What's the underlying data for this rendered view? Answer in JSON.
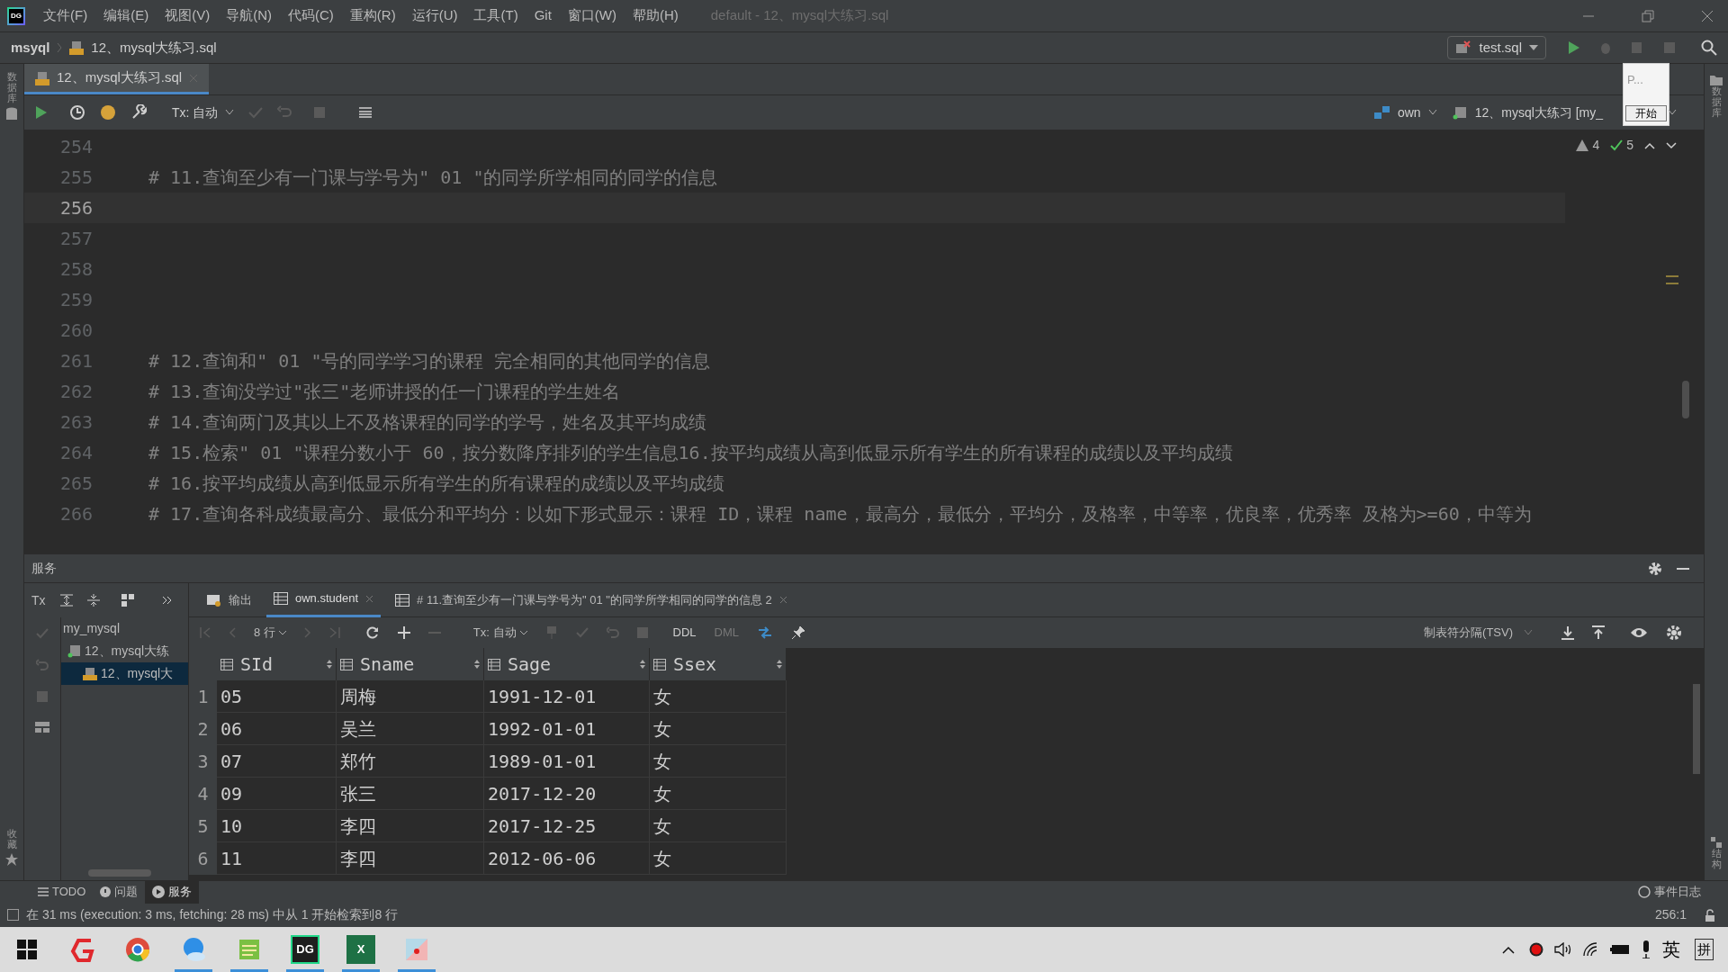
{
  "window": {
    "logo": "DG",
    "title": "default - 12、mysql大练习.sql",
    "menu": [
      "文件(F)",
      "编辑(E)",
      "视图(V)",
      "导航(N)",
      "代码(C)",
      "重构(R)",
      "运行(U)",
      "工具(T)",
      "Git",
      "窗口(W)",
      "帮助(H)"
    ]
  },
  "navbar": {
    "breadcrumb": [
      "msyql",
      "12、mysql大练习.sql"
    ],
    "run_config": "test.sql"
  },
  "editor_tabs": [
    {
      "label": "12、mysql大练习.sql",
      "selected": true
    }
  ],
  "editor_toolbar": {
    "tx": "Tx: 自动",
    "schema": "own",
    "session": "12、mysql大练习 [my_"
  },
  "popup": {
    "text": "P...",
    "button": "开始"
  },
  "inspections": {
    "warnings": "4",
    "passed": "5"
  },
  "editor": {
    "lines": [
      {
        "number": "254",
        "current": false
      },
      {
        "number": "255",
        "text": "# 11.查询至少有一门课与学号为\" 01 \"的同学所学相同的同学的信息",
        "current": false
      },
      {
        "number": "256",
        "current": true
      },
      {
        "number": "257",
        "current": false
      },
      {
        "number": "258",
        "current": false
      },
      {
        "number": "259",
        "current": false
      },
      {
        "number": "260",
        "current": false
      },
      {
        "number": "261",
        "text": "# 12.查询和\" 01 \"号的同学学习的课程 完全相同的其他同学的信息",
        "current": false
      },
      {
        "number": "262",
        "text": "# 13.查询没学过\"张三\"老师讲授的任一门课程的学生姓名",
        "current": false
      },
      {
        "number": "263",
        "text": "# 14.查询两门及其以上不及格课程的同学的学号，姓名及其平均成绩",
        "current": false
      },
      {
        "number": "264",
        "text": "# 15.检索\" 01 \"课程分数小于 60，按分数降序排列的学生信息16.按平均成绩从高到低显示所有学生的所有课程的成绩以及平均成绩",
        "current": false
      },
      {
        "number": "265",
        "text": "# 16.按平均成绩从高到低显示所有学生的所有课程的成绩以及平均成绩",
        "current": false
      },
      {
        "number": "266",
        "text": "# 17.查询各科成绩最高分、最低分和平均分：以如下形式显示：课程 ID，课程 name，最高分，最低分，平均分，及格率，中等率，优良率，优秀率 及格为>=60，中等为",
        "current": false
      }
    ]
  },
  "side_labels": {
    "left_top": "数据库",
    "left_bottom": "收藏",
    "right_top": "数据库",
    "right_bottom": "结构"
  },
  "services": {
    "title": "服务",
    "tree_tx": "Tx",
    "tree": [
      {
        "label": "my_mysql",
        "selected": false,
        "children": [
          {
            "label": "12、mysql大练",
            "kind": "session",
            "selected": false,
            "children": [
              {
                "label": "12、mysql大",
                "kind": "file",
                "selected": true
              }
            ]
          }
        ]
      }
    ],
    "tabs": [
      {
        "label": "输出",
        "kind": "output",
        "selected": false
      },
      {
        "label": "own.student",
        "kind": "table",
        "selected": true
      },
      {
        "label": "# 11.查询至少有一门课与学号为\" 01 \"的同学所学相同的同学的信息 2",
        "kind": "table",
        "selected": false
      }
    ],
    "toolbar": {
      "rows": "8 行",
      "tx": "Tx: 自动",
      "ddl": "DDL",
      "dml": "DML",
      "format": "制表符分隔(TSV)"
    },
    "table": {
      "columns": [
        "SId",
        "Sname",
        "Sage",
        "Ssex"
      ],
      "rows": [
        {
          "number": "1",
          "cells": [
            "05",
            "周梅",
            "1991-12-01",
            "女"
          ]
        },
        {
          "number": "2",
          "cells": [
            "06",
            "吴兰",
            "1992-01-01",
            "女"
          ]
        },
        {
          "number": "3",
          "cells": [
            "07",
            "郑竹",
            "1989-01-01",
            "女"
          ]
        },
        {
          "number": "4",
          "cells": [
            "09",
            "张三",
            "2017-12-20",
            "女"
          ]
        },
        {
          "number": "5",
          "cells": [
            "10",
            "李四",
            "2017-12-25",
            "女"
          ]
        },
        {
          "number": "6",
          "cells": [
            "11",
            "李四",
            "2012-06-06",
            "女"
          ]
        }
      ]
    }
  },
  "tool_tabs": [
    {
      "label": "TODO",
      "kind": "list",
      "selected": false
    },
    {
      "label": "问题",
      "kind": "info",
      "selected": false
    },
    {
      "label": "服务",
      "kind": "play",
      "selected": true
    }
  ],
  "status_bar": {
    "message": "在 31 ms (execution: 3 ms, fetching: 28 ms) 中从 1 开始检索到8 行",
    "event_log": "事件日志",
    "position": "256:1"
  },
  "taskbar": {
    "apps": [
      {
        "kind": "g-app",
        "running": false
      },
      {
        "kind": "chrome",
        "running": false
      },
      {
        "kind": "cloud-browser",
        "running": true
      },
      {
        "kind": "notepad",
        "running": true
      },
      {
        "kind": "datagrip",
        "label": "DG",
        "running": true
      },
      {
        "kind": "excel",
        "label": "X",
        "running": true
      },
      {
        "kind": "paint",
        "running": true
      }
    ],
    "ime": "英",
    "ime_mode": "拼"
  }
}
